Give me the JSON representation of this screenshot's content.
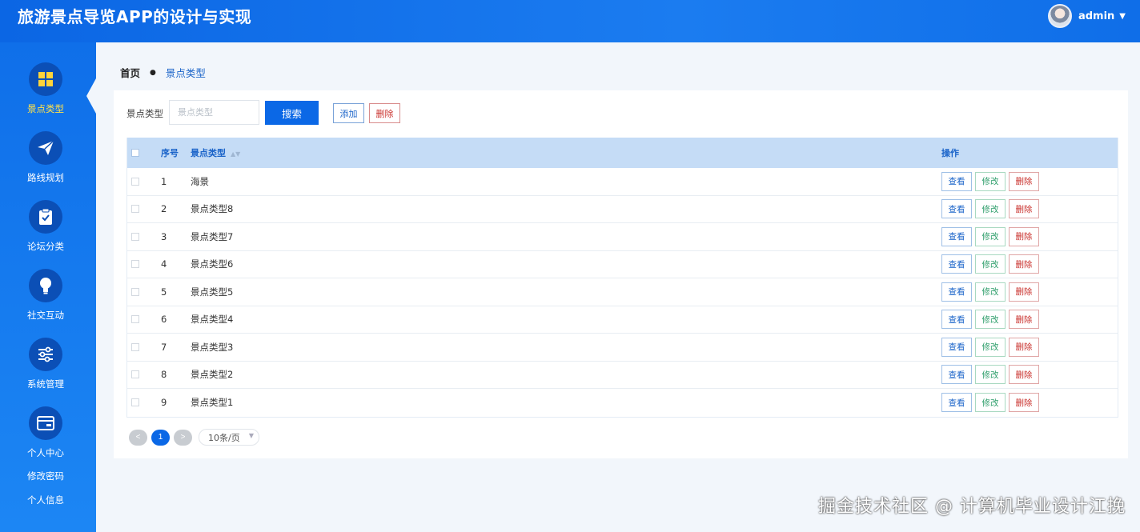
{
  "header": {
    "title": "旅游景点导览APP的设计与实现",
    "user_name": "admin"
  },
  "sidebar": {
    "items": [
      {
        "label": "景点类型",
        "icon": "grid-icon",
        "active": true
      },
      {
        "label": "路线规划",
        "icon": "paper-plane-icon"
      },
      {
        "label": "论坛分类",
        "icon": "clipboard-check-icon"
      },
      {
        "label": "社交互动",
        "icon": "lightbulb-icon"
      },
      {
        "label": "系统管理",
        "icon": "sliders-icon"
      },
      {
        "label": "个人中心",
        "icon": "card-icon"
      }
    ],
    "sub_links": [
      "修改密码",
      "个人信息"
    ]
  },
  "breadcrumb": {
    "home": "首页",
    "current": "景点类型"
  },
  "search": {
    "label": "景点类型",
    "placeholder": "景点类型",
    "button": "搜索"
  },
  "toolbar": {
    "add_label": "添加",
    "delete_label": "删除"
  },
  "table": {
    "columns": [
      "序号",
      "景点类型",
      "操作"
    ],
    "rows": [
      {
        "index": "1",
        "type": "海景"
      },
      {
        "index": "2",
        "type": "景点类型8"
      },
      {
        "index": "3",
        "type": "景点类型7"
      },
      {
        "index": "4",
        "type": "景点类型6"
      },
      {
        "index": "5",
        "type": "景点类型5"
      },
      {
        "index": "6",
        "type": "景点类型4"
      },
      {
        "index": "7",
        "type": "景点类型3"
      },
      {
        "index": "8",
        "type": "景点类型2"
      },
      {
        "index": "9",
        "type": "景点类型1"
      }
    ],
    "actions": {
      "view": "查看",
      "edit": "修改",
      "delete": "删除"
    }
  },
  "pagination": {
    "prev": "<",
    "current_page": "1",
    "next": ">",
    "page_size": "10条/页"
  },
  "watermark": "掘金技术社区 @ 计算机毕业设计江挽",
  "colors": {
    "header": "#0b66e4",
    "sidebar": "#1577ee",
    "primary": "#0b68e6",
    "active_nav_text": "#ffe14a",
    "table_header": "#c5dcf6",
    "danger": "#c9302c",
    "edit": "#2e9e6b"
  }
}
